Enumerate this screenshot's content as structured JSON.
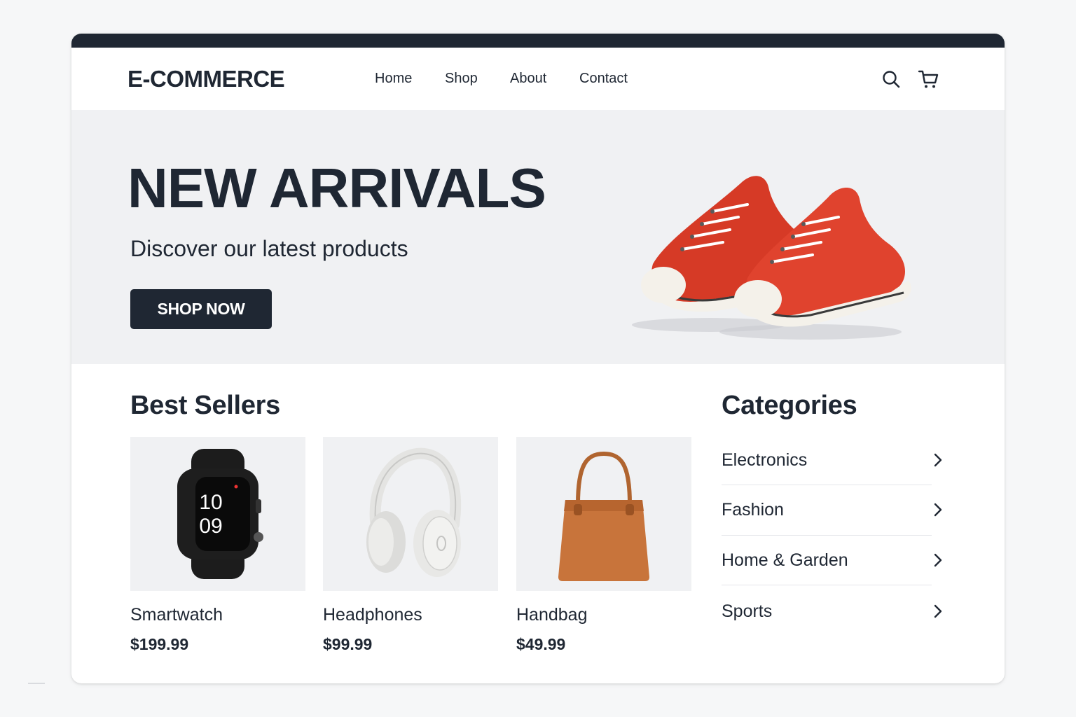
{
  "header": {
    "logo": "E-COMMERCE",
    "nav": [
      {
        "label": "Home"
      },
      {
        "label": "Shop"
      },
      {
        "label": "About"
      },
      {
        "label": "Contact"
      }
    ],
    "icons": [
      "search-icon",
      "cart-icon"
    ]
  },
  "hero": {
    "title": "NEW ARRIVALS",
    "subtitle": "Discover our latest products",
    "button": "SHOP NOW",
    "image": "red-sneakers"
  },
  "best_sellers": {
    "title": "Best Sellers",
    "products": [
      {
        "name": "Smartwatch",
        "price": "$199.99",
        "image": "smartwatch",
        "watch_hour": "10",
        "watch_minute": "09"
      },
      {
        "name": "Headphones",
        "price": "$99.99",
        "image": "headphones"
      },
      {
        "name": "Handbag",
        "price": "$49.99",
        "image": "handbag"
      }
    ]
  },
  "categories": {
    "title": "Categories",
    "items": [
      {
        "label": "Electronics"
      },
      {
        "label": "Fashion"
      },
      {
        "label": "Home & Garden"
      },
      {
        "label": "Sports"
      }
    ]
  },
  "colors": {
    "primary": "#1f2733",
    "hero_bg": "#f0f1f3",
    "sneaker_red": "#d63a26"
  }
}
